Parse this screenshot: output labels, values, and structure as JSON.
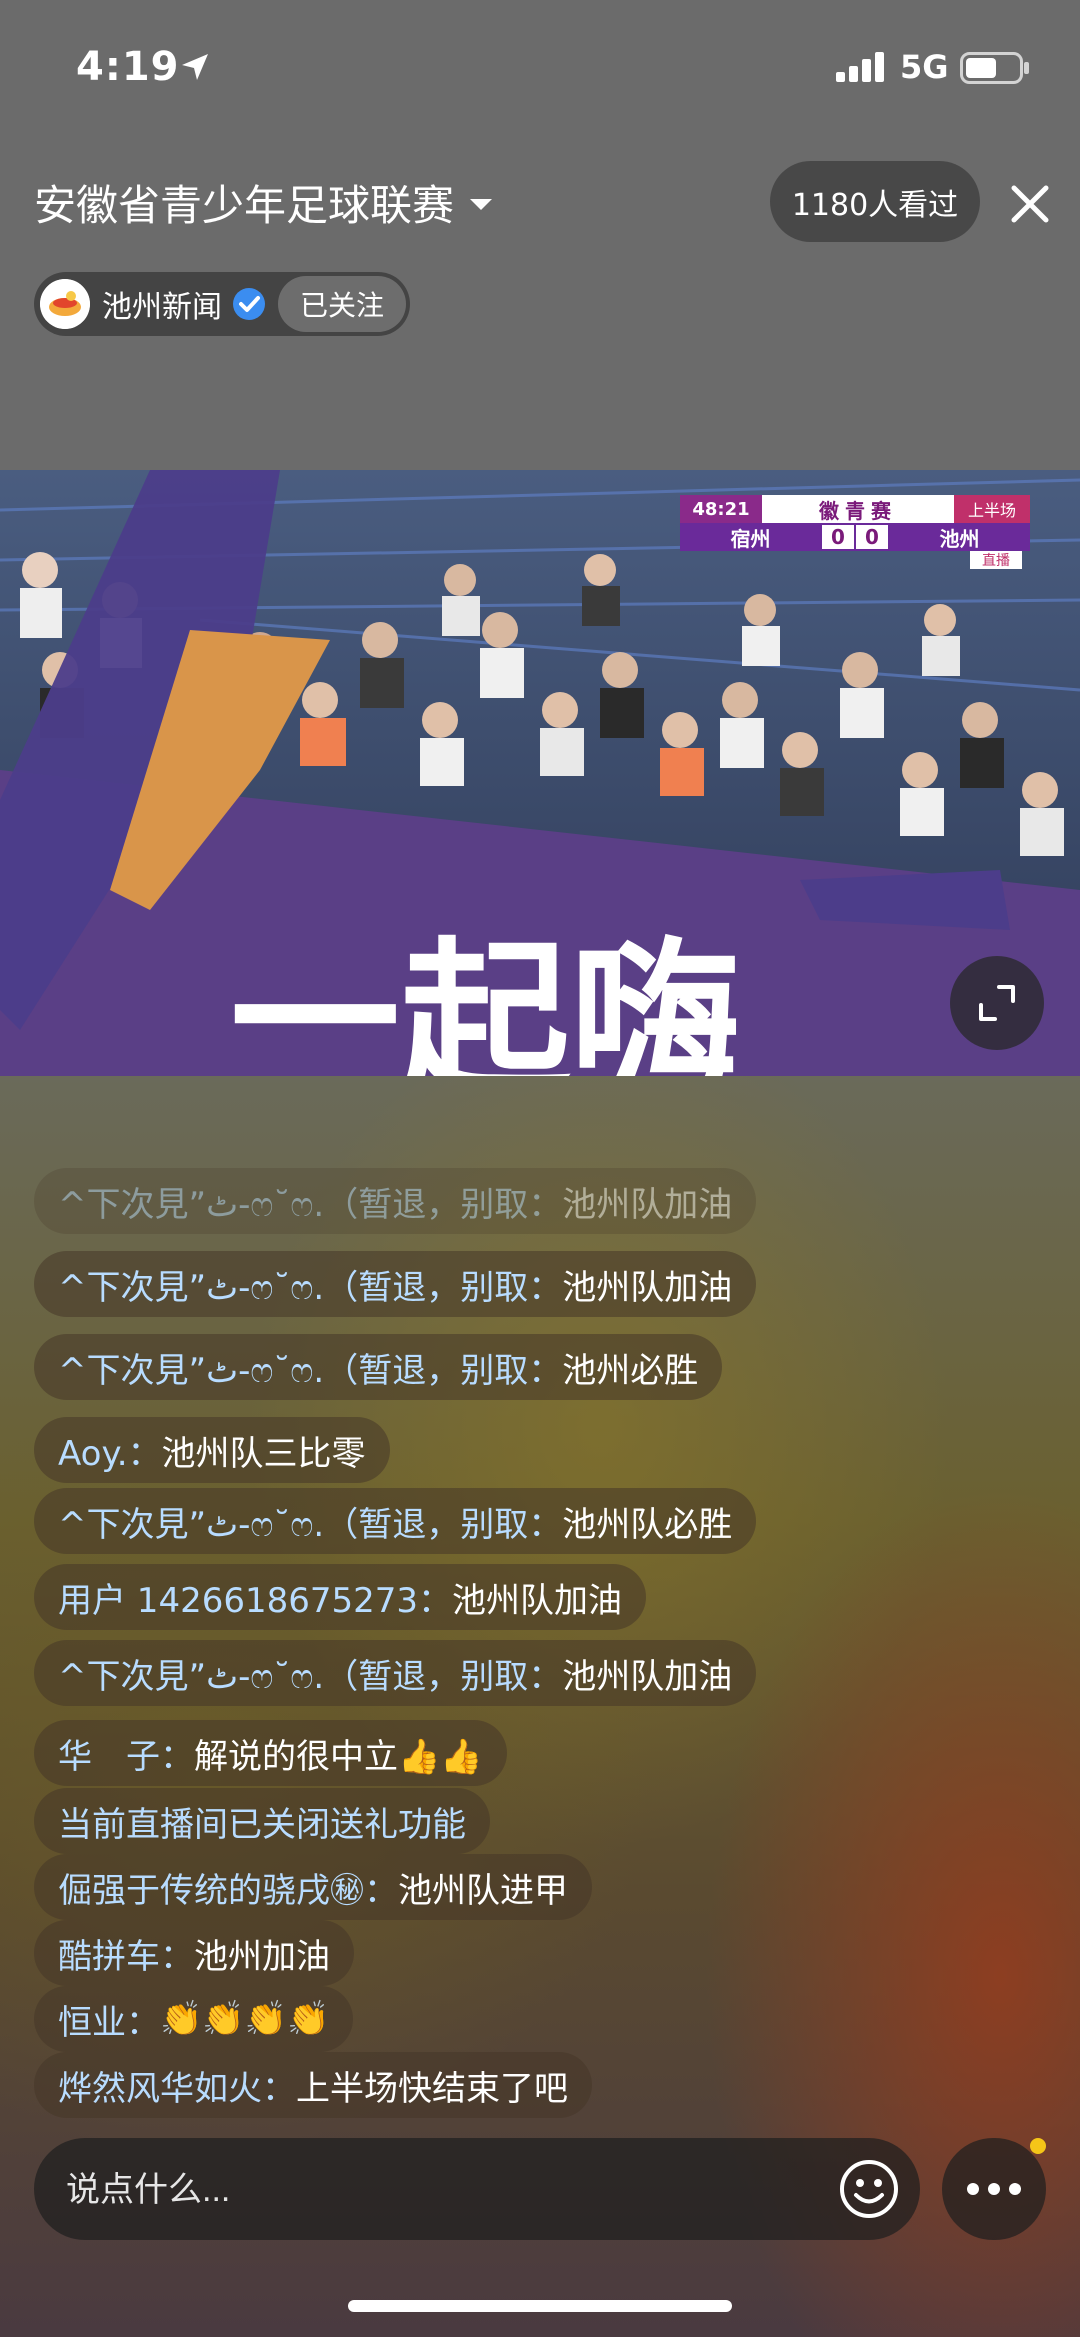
{
  "status_bar": {
    "time": "4:19",
    "network": "5G"
  },
  "header": {
    "title": "安徽省青少年足球联赛",
    "viewers": "1180人看过",
    "channel_name": "池州新闻",
    "follow_label": "已关注"
  },
  "scoreboard": {
    "clock": "48:21",
    "league": "徽青赛",
    "half": "上半场",
    "home_team": "宿州",
    "home_score": "0",
    "away_score": "0",
    "away_team": "池州",
    "live": "直播"
  },
  "video_banner_text": "一起嗨",
  "chat": [
    {
      "user": "^下次見”ٹ-ෆ˘ෆ.（暂退，别取：",
      "text": "池州队加油",
      "faded": true
    },
    {
      "user": "^下次見”ٹ-ෆ˘ෆ.（暂退，别取：",
      "text": "池州队加油"
    },
    {
      "user": "^下次見”ٹ-ෆ˘ෆ.（暂退，别取：",
      "text": "池州必胜"
    },
    {
      "user": "Aoy.：",
      "text": "池州队三比零"
    },
    {
      "user": "^下次見”ٹ-ෆ˘ෆ.（暂退，别取：",
      "text": "池州队必胜"
    },
    {
      "user": "用户 1426618675273：",
      "text": "池州队加油"
    },
    {
      "user": "^下次見”ٹ-ෆ˘ෆ.（暂退，别取：",
      "text": "池州队加油"
    },
    {
      "user": "华　子：",
      "text": "解说的很中立👍👍"
    },
    {
      "user": "当前直播间已关闭送礼功能",
      "text": ""
    },
    {
      "user": "倔强于传统的骁戌㊙：",
      "text": "池州队进甲"
    },
    {
      "user": "酷拼车：",
      "text": "池州加油"
    },
    {
      "user": "恒业：",
      "text": "👏👏👏👏"
    },
    {
      "user": "烨然风华如火：",
      "text": "上半场快结束了吧"
    }
  ],
  "input": {
    "placeholder": "说点什么..."
  },
  "colors": {
    "accent_user": "#b8dcff",
    "notify_dot": "#f5c518",
    "verified": "#3b8df0"
  }
}
